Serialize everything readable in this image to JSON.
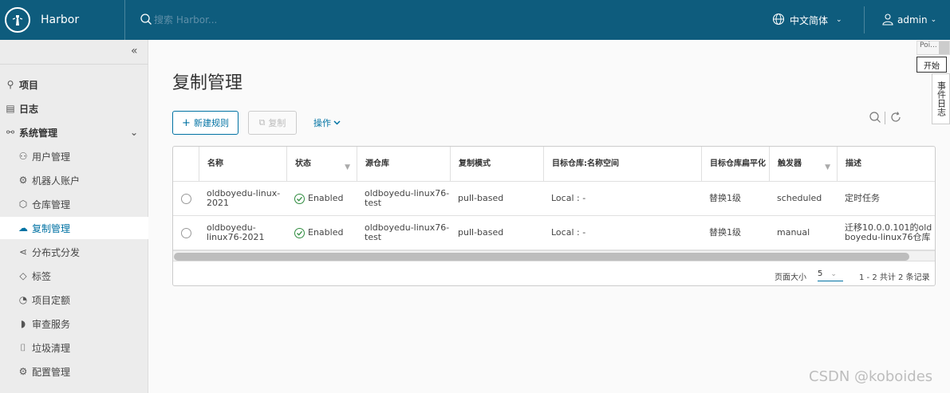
{
  "header": {
    "brand": "Harbor",
    "search_placeholder": "搜索 Harbor...",
    "language": "中文简体",
    "user": "admin"
  },
  "sidebar": {
    "items": [
      {
        "label": "项目",
        "icon": "project-icon"
      },
      {
        "label": "日志",
        "icon": "log-icon"
      },
      {
        "label": "系统管理",
        "icon": "system-admin-icon"
      },
      {
        "label": "用户管理",
        "icon": "users-icon"
      },
      {
        "label": "机器人账户",
        "icon": "robot-icon"
      },
      {
        "label": "仓库管理",
        "icon": "registry-icon"
      },
      {
        "label": "复制管理",
        "icon": "replication-icon"
      },
      {
        "label": "分布式分发",
        "icon": "share-icon"
      },
      {
        "label": "标签",
        "icon": "tag-icon"
      },
      {
        "label": "项目定额",
        "icon": "quota-icon"
      },
      {
        "label": "审查服务",
        "icon": "shield-icon"
      },
      {
        "label": "垃圾清理",
        "icon": "trash-icon"
      },
      {
        "label": "配置管理",
        "icon": "gear-icon"
      }
    ]
  },
  "page": {
    "title": "复制管理",
    "new_rule": "新建规则",
    "copy": "复制",
    "operations": "操作"
  },
  "table": {
    "headers": [
      "名称",
      "状态",
      "源仓库",
      "复制模式",
      "目标仓库:名称空间",
      "目标仓库扁平化",
      "触发器",
      "描述"
    ],
    "rows": [
      {
        "name": "oldboyedu-linux-2021",
        "status": "Enabled",
        "source": "oldboyedu-linux76-test",
        "mode": "pull-based",
        "dest": "Local : -",
        "flatten": "替换1级",
        "trigger": "scheduled",
        "desc": "定时任务"
      },
      {
        "name": "oldboyedu-linux76-2021",
        "status": "Enabled",
        "source": "oldboyedu-linux76-test",
        "mode": "pull-based",
        "dest": "Local : -",
        "flatten": "替换1级",
        "trigger": "manual",
        "desc": "迁移10.0.0.101的oldboyedu-linux76仓库"
      }
    ],
    "footer": {
      "page_size_label": "页面大小",
      "page_size": "5",
      "total": "1 - 2 共计 2 条记录"
    }
  },
  "widget": {
    "top_text": "Poi...",
    "button": "开始",
    "tab": "事件日志"
  },
  "watermark": "CSDN @koboides",
  "colors": {
    "header": "#0e5c7d",
    "accent": "#0072a3",
    "enabled": "#2e8b3e"
  }
}
